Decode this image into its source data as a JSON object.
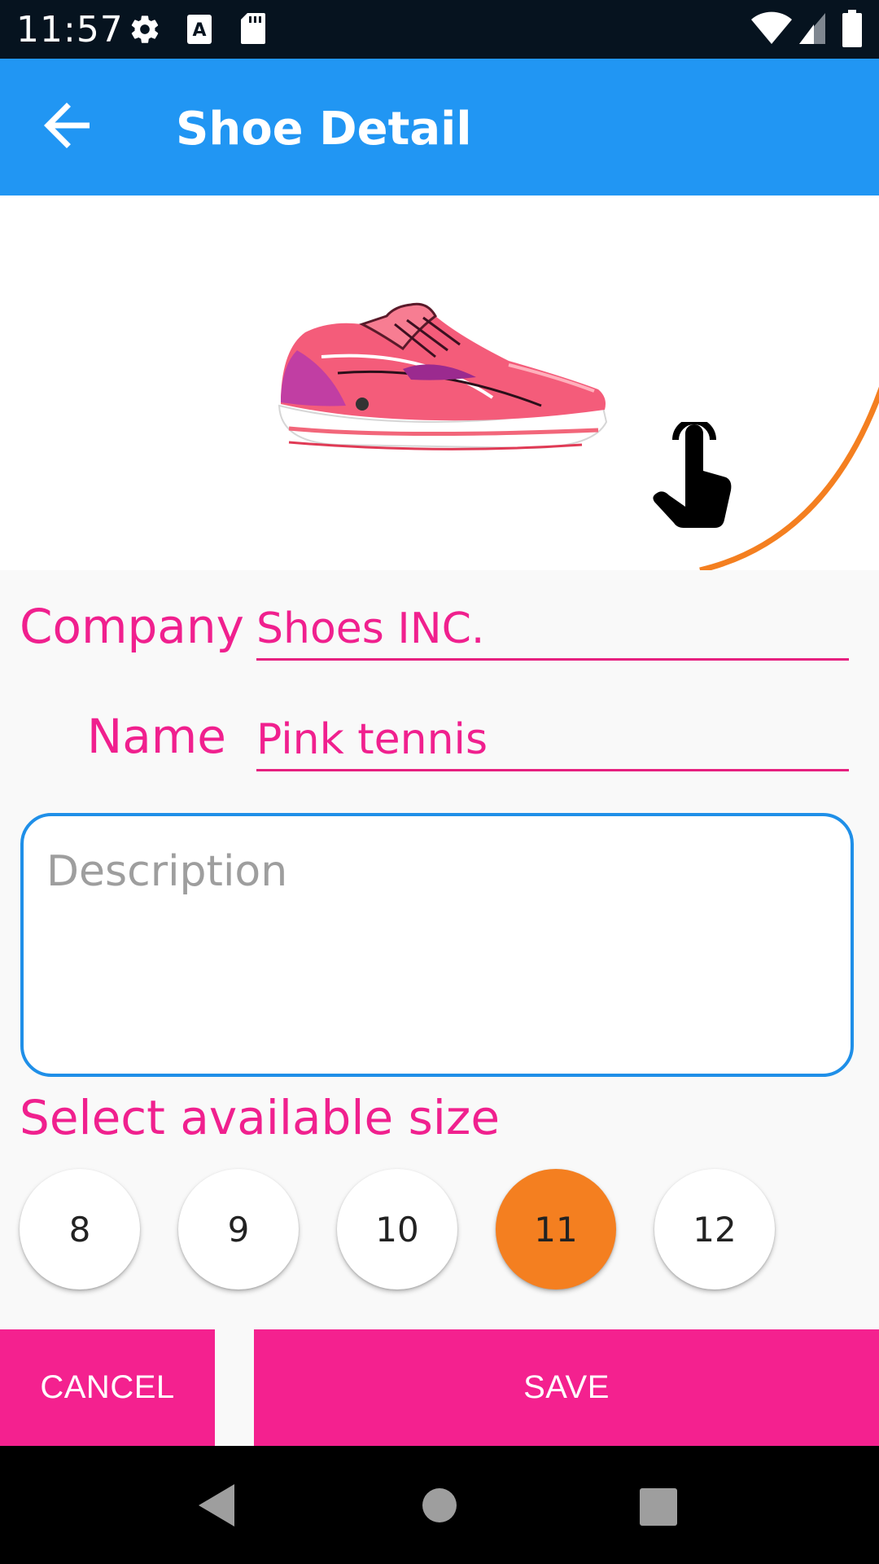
{
  "status_bar": {
    "time": "11:57",
    "icons": [
      "gear-icon",
      "a-icon",
      "sd-card-icon",
      "wifi-icon",
      "signal-icon",
      "battery-icon"
    ]
  },
  "app_bar": {
    "title": "Shoe Detail",
    "back_icon": "arrow-back-icon"
  },
  "image_section": {
    "image_icon": "pink-running-shoe",
    "tap_icon": "hand-pointer-icon"
  },
  "form": {
    "company_label": "Company",
    "company_value": "Shoes INC.",
    "name_label": "Name",
    "name_value": "Pink tennis",
    "description_placeholder": "Description",
    "description_value": ""
  },
  "sizes": {
    "title": "Select available size",
    "options": [
      "8",
      "9",
      "10",
      "11",
      "12"
    ],
    "selected": "11"
  },
  "actions": {
    "cancel_label": "CANCEL",
    "save_label": "SAVE"
  },
  "colors": {
    "primary": "#2196f3",
    "accent_pink": "#f4218f",
    "accent_orange": "#f47f20"
  },
  "nav_bar": {
    "icons": [
      "back-triangle-icon",
      "home-circle-icon",
      "recents-square-icon"
    ]
  }
}
